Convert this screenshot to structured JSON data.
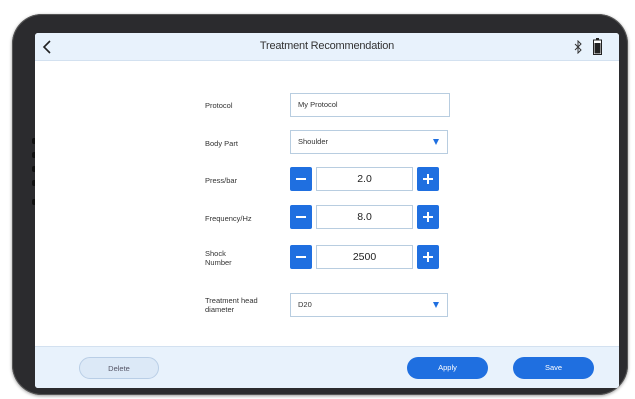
{
  "header": {
    "title": "Treatment Recommendation"
  },
  "form": {
    "protocol": {
      "label": "Protocol",
      "value": "My Protocol"
    },
    "body_part": {
      "label": "Body Part",
      "value": "Shoulder"
    },
    "press": {
      "label": "Press/bar",
      "value": "2.0"
    },
    "frequency": {
      "label": "Frequency/Hz",
      "value": "8.0"
    },
    "shock_number": {
      "label_line1": "Shock",
      "label_line2": "Number",
      "value": "2500"
    },
    "head_diameter": {
      "label_line1": "Treatment head",
      "label_line2": "diameter",
      "value": "D20"
    }
  },
  "footer": {
    "delete_label": "Delete",
    "apply_label": "Apply",
    "save_label": "Save"
  },
  "colors": {
    "accent": "#1f6fe0",
    "bar_background": "#e8f2fc",
    "device_frame": "#2b2b2e"
  },
  "icons": [
    "back-chevron-icon",
    "bluetooth-icon",
    "battery-icon",
    "minus-icon",
    "plus-icon",
    "dropdown-caret-icon"
  ]
}
